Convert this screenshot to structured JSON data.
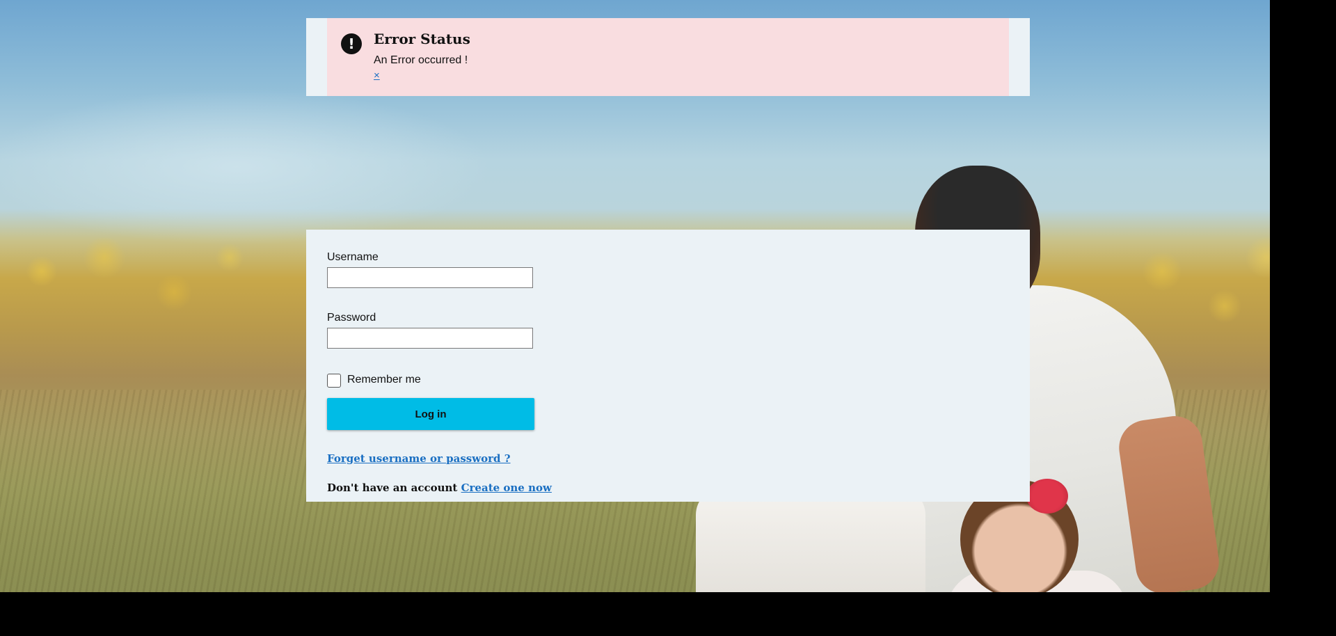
{
  "alert": {
    "icon": "exclamation-circle-icon",
    "icon_glyph": "!",
    "title": "Error Status",
    "message": "An Error occurred !",
    "close_label": "×",
    "background_color": "#f9dde0"
  },
  "login": {
    "username_label": "Username",
    "username_value": "",
    "password_label": "Password",
    "password_value": "",
    "remember_label": "Remember me",
    "remember_checked": false,
    "submit_label": "Log in",
    "submit_color": "#00bce6",
    "forgot_link": "Forget username or password ?",
    "signup_prompt": "Don't have an account",
    "signup_link": "Create one now",
    "link_color": "#1a6fc2"
  }
}
